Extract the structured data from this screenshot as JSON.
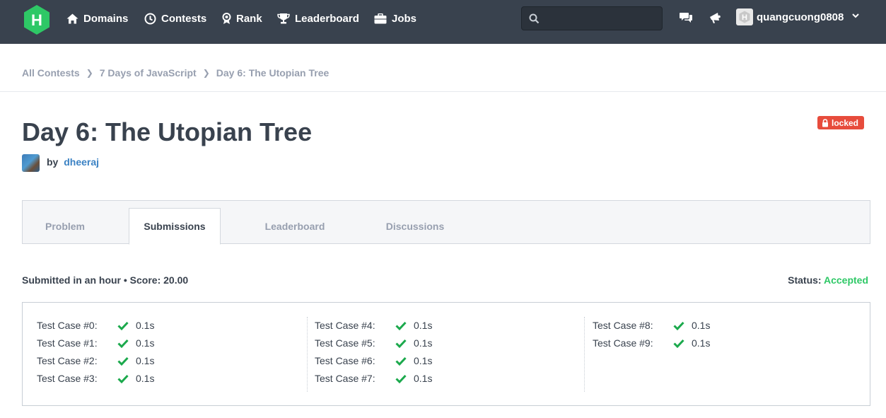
{
  "nav": {
    "logo": "H",
    "items": [
      {
        "label": "Domains",
        "icon": "home-icon"
      },
      {
        "label": "Contests",
        "icon": "clock-icon"
      },
      {
        "label": "Rank",
        "icon": "medal-icon"
      },
      {
        "label": "Leaderboard",
        "icon": "trophy-icon"
      },
      {
        "label": "Jobs",
        "icon": "briefcase-icon"
      }
    ],
    "search_placeholder": "",
    "username": "quangcuong0808"
  },
  "breadcrumb": [
    "All Contests",
    "7 Days of JavaScript",
    "Day 6: The Utopian Tree"
  ],
  "challenge": {
    "title": "Day 6: The Utopian Tree",
    "locked_label": "locked",
    "by_label": "by",
    "author": "dheeraj"
  },
  "tabs": [
    {
      "label": "Problem",
      "active": false
    },
    {
      "label": "Submissions",
      "active": true
    },
    {
      "label": "Leaderboard",
      "active": false
    },
    {
      "label": "Discussions",
      "active": false
    }
  ],
  "submission": {
    "summary": "Submitted in an hour • Score: 20.00",
    "status_label": "Status:",
    "status_value": "Accepted"
  },
  "test_cases": [
    {
      "label": "Test Case #0:",
      "time": "0.1s"
    },
    {
      "label": "Test Case #1:",
      "time": "0.1s"
    },
    {
      "label": "Test Case #2:",
      "time": "0.1s"
    },
    {
      "label": "Test Case #3:",
      "time": "0.1s"
    },
    {
      "label": "Test Case #4:",
      "time": "0.1s"
    },
    {
      "label": "Test Case #5:",
      "time": "0.1s"
    },
    {
      "label": "Test Case #6:",
      "time": "0.1s"
    },
    {
      "label": "Test Case #7:",
      "time": "0.1s"
    },
    {
      "label": "Test Case #8:",
      "time": "0.1s"
    },
    {
      "label": "Test Case #9:",
      "time": "0.1s"
    }
  ],
  "colors": {
    "nav_bg": "#39424e",
    "brand_green": "#2ec866",
    "locked_red": "#e74c3c",
    "link_blue": "#3b82c4"
  }
}
